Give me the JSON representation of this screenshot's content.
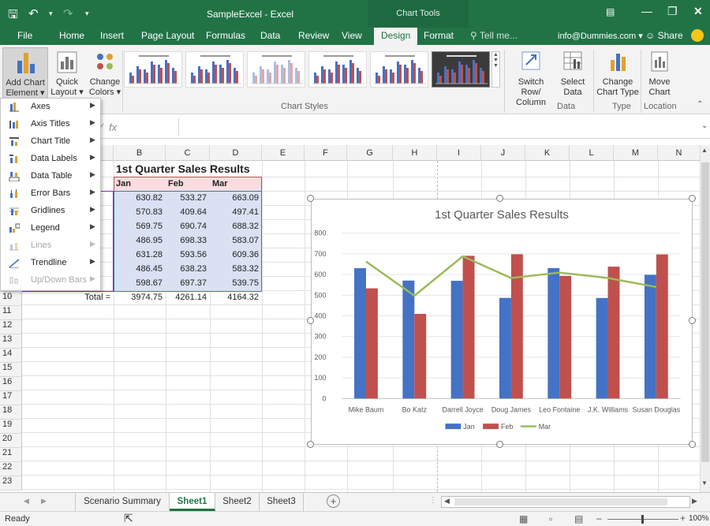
{
  "titlebar": {
    "doc_title": "SampleExcel - Excel",
    "context_tab": "Chart Tools"
  },
  "menu": {
    "tabs": [
      "File",
      "Home",
      "Insert",
      "Page Layout",
      "Formulas",
      "Data",
      "Review",
      "View",
      "Design",
      "Format"
    ],
    "active_tab": "Design",
    "tell_me": "Tell me...",
    "account": "info@Dummies.com",
    "share": "Share"
  },
  "ribbon": {
    "add_chart_element": [
      "Add Chart",
      "Element"
    ],
    "quick_layout": [
      "Quick",
      "Layout"
    ],
    "change_colors": [
      "Change",
      "Colors"
    ],
    "switch_row_col": [
      "Switch Row/",
      "Column"
    ],
    "select_data": [
      "Select",
      "Data"
    ],
    "change_chart_type": [
      "Change",
      "Chart Type"
    ],
    "move_chart": [
      "Move",
      "Chart"
    ],
    "group_chart_styles": "Chart Styles",
    "group_data": "Data",
    "group_type": "Type",
    "group_location": "Location"
  },
  "dropdown": {
    "items": [
      {
        "label": "Axes",
        "enabled": true
      },
      {
        "label": "Axis Titles",
        "enabled": true
      },
      {
        "label": "Chart Title",
        "enabled": true
      },
      {
        "label": "Data Labels",
        "enabled": true
      },
      {
        "label": "Data Table",
        "enabled": true
      },
      {
        "label": "Error Bars",
        "enabled": true
      },
      {
        "label": "Gridlines",
        "enabled": true
      },
      {
        "label": "Legend",
        "enabled": true
      },
      {
        "label": "Lines",
        "enabled": false
      },
      {
        "label": "Trendline",
        "enabled": true
      },
      {
        "label": "Up/Down Bars",
        "enabled": false
      }
    ]
  },
  "formula": {
    "fx": "fx",
    "value": ""
  },
  "columns": [
    "B",
    "C",
    "D",
    "E",
    "F",
    "G",
    "H",
    "I",
    "J",
    "K",
    "L",
    "M",
    "N"
  ],
  "rows": [
    "10",
    "11",
    "12",
    "13",
    "14",
    "15",
    "16",
    "17",
    "18",
    "19",
    "20",
    "21",
    "22",
    "23"
  ],
  "sheet": {
    "title": "1st Quarter Sales Results",
    "headers": [
      "Jan",
      "Feb",
      "Mar"
    ],
    "data": [
      [
        "630.82",
        "533.27",
        "663.09"
      ],
      [
        "570.83",
        "409.64",
        "497.41"
      ],
      [
        "569.75",
        "690.74",
        "688.32"
      ],
      [
        "486.95",
        "698.33",
        "583.07"
      ],
      [
        "631.28",
        "593.56",
        "609.36"
      ],
      [
        "486.45",
        "638.23",
        "583.32"
      ],
      [
        "598.67",
        "697.37",
        "539.75"
      ]
    ],
    "total_label": "Total =",
    "totals": [
      "3974.75",
      "4261.14",
      "4164.32"
    ]
  },
  "sheet_tabs": [
    "Scenario Summary",
    "Sheet1",
    "Sheet2",
    "Sheet3"
  ],
  "active_sheet": "Sheet1",
  "status": {
    "ready": "Ready",
    "zoom": "100%"
  },
  "colors": {
    "excel_green": "#217346",
    "jan": "#4472c4",
    "feb": "#c0504d",
    "mar": "#9bbb59"
  },
  "chart_data": {
    "type": "bar",
    "title": "1st Quarter Sales Results",
    "categories": [
      "Mike Baum",
      "Bo Katz",
      "Darrell Joyce",
      "Doug James",
      "Leo Fontaine",
      "J.K. Williams",
      "Susan Douglas"
    ],
    "series": [
      {
        "name": "Jan",
        "type": "bar",
        "values": [
          630.82,
          570.83,
          569.75,
          486.95,
          631.28,
          486.45,
          598.67
        ]
      },
      {
        "name": "Feb",
        "type": "bar",
        "values": [
          533.27,
          409.64,
          690.74,
          698.33,
          593.56,
          638.23,
          697.37
        ]
      },
      {
        "name": "Mar",
        "type": "line",
        "values": [
          663.09,
          497.41,
          688.32,
          583.07,
          609.36,
          583.32,
          539.75
        ]
      }
    ],
    "ylim": [
      0,
      800
    ],
    "yticks": [
      0,
      100,
      200,
      300,
      400,
      500,
      600,
      700,
      800
    ],
    "grid": true,
    "legend": "bottom",
    "xlabel": "",
    "ylabel": ""
  }
}
